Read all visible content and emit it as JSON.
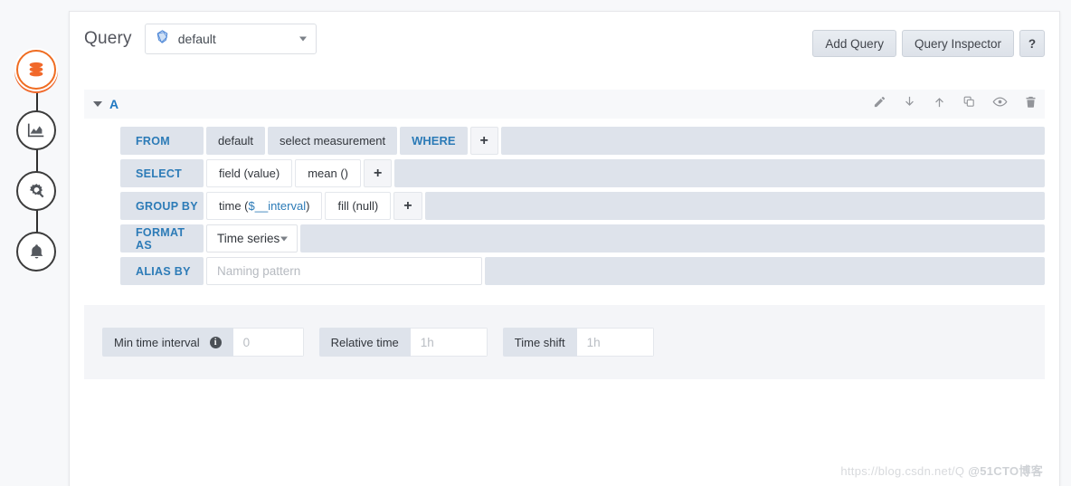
{
  "sidebar": {
    "items": [
      {
        "name": "datasource-step",
        "icon": "database-icon",
        "active": true
      },
      {
        "name": "visualization-step",
        "icon": "area-chart-icon",
        "active": false
      },
      {
        "name": "general-settings-step",
        "icon": "gear-wand-icon",
        "active": false
      },
      {
        "name": "alerts-step",
        "icon": "bell-icon",
        "active": false
      }
    ]
  },
  "header": {
    "title": "Query",
    "datasource": {
      "icon": "influxdb-icon",
      "value": "default",
      "caret": "chevron-down-icon"
    },
    "actions": {
      "add_query": "Add Query",
      "query_inspector": "Query Inspector",
      "help": "?"
    }
  },
  "query": {
    "ref_id": "A",
    "collapse_icon": "chevron-down-icon",
    "row_icons": [
      "pencil-icon",
      "arrow-down-icon",
      "arrow-up-icon",
      "duplicate-icon",
      "eye-icon",
      "trash-icon"
    ],
    "rows": {
      "from": {
        "label": "FROM",
        "policy": "default",
        "measurement": "select measurement",
        "where": "WHERE",
        "add": "+"
      },
      "select": {
        "label": "SELECT",
        "field": "field (value)",
        "func": "mean ()",
        "add": "+"
      },
      "group_by": {
        "label": "GROUP BY",
        "time_prefix": "time (",
        "time_var": "$__interval",
        "time_suffix": ")",
        "fill": "fill (null)",
        "add": "+"
      },
      "format_as": {
        "label": "FORMAT AS",
        "value": "Time series",
        "caret": "chevron-down-icon"
      },
      "alias_by": {
        "label": "ALIAS BY",
        "value": "",
        "placeholder": "Naming pattern"
      }
    }
  },
  "options": {
    "min_time_interval": {
      "label": "Min time interval",
      "info_icon": "info-icon",
      "value": "",
      "placeholder": "0"
    },
    "relative_time": {
      "label": "Relative time",
      "value": "",
      "placeholder": "1h"
    },
    "time_shift": {
      "label": "Time shift",
      "value": "",
      "placeholder": "1h"
    }
  },
  "watermark": {
    "url": "https://blog.csdn.net/Q",
    "tag": "@51CTO博客"
  },
  "colors": {
    "accent_orange": "#f1682a",
    "link_blue": "#2c7bb7",
    "segment_bg": "#dee3eb",
    "panel_bg": "#ffffff"
  }
}
